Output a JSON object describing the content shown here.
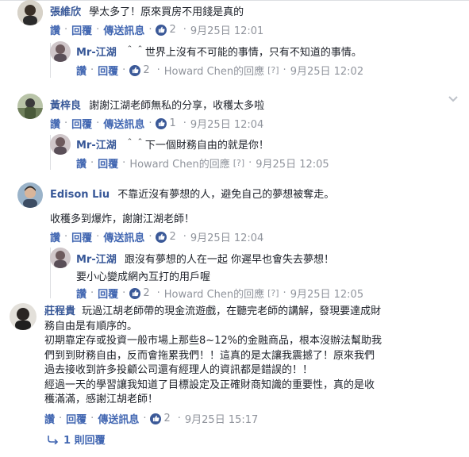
{
  "comments": [
    {
      "author": "張維欣",
      "text": "學太多了！原來買房不用錢是真的",
      "actions": {
        "like": "讚",
        "reply": "回覆",
        "message": "傳送訊息"
      },
      "reactions": "2",
      "time": "9月25日 12:01",
      "reply": {
        "author": "Mr-江湖",
        "text": "＾＾世界上沒有不可能的事情，只有不知道的事情。",
        "like": "讚",
        "reply": "回覆",
        "reactions": "2",
        "replied_to": "Howard Chen的回應",
        "help": "[?]",
        "time": "9月25日 12:02"
      }
    },
    {
      "author": "黃梓良",
      "text": "謝謝江湖老師無私的分享，收穫太多啦",
      "actions": {
        "like": "讚",
        "reply": "回覆",
        "message": "傳送訊息"
      },
      "reactions": "1",
      "time": "9月25日 12:04",
      "reply": {
        "author": "Mr-江湖",
        "text": "＾＾下一個財務自由的就是你！",
        "like": "讚",
        "reply": "回覆",
        "replied_to": "Howard Chen的回應",
        "help": "[?]",
        "time": "9月25日 12:05"
      }
    },
    {
      "author": "Edison Liu",
      "text": "不靠近沒有夢想的人，避免自己的夢想被奪走。",
      "text2": "收穫多到爆炸，謝謝江湖老師！",
      "actions": {
        "like": "讚",
        "reply": "回覆",
        "message": "傳送訊息"
      },
      "reactions": "2",
      "time": "9月25日 12:04",
      "reply": {
        "author": "Mr-江湖",
        "text": "跟沒有夢想的人在一起 你遲早也會失去夢想！",
        "text2": "要小心變成網內互打的用戶喔",
        "like": "讚",
        "reply": "回覆",
        "reactions": "2",
        "replied_to": "Howard Chen的回應",
        "help": "[?]",
        "time": "9月25日 12:05"
      }
    },
    {
      "author": "莊程貴",
      "lines": [
        "玩過江胡老師帶的現金流遊戲，在聽完老師的講解，發現要達成財",
        "務自由是有順序的。",
        "初期靠定存或投資一般市場上那些8~12%的金融商品，根本沒辦法幫助我",
        "們到到財務自由，反而會拖累我們！！這真的是太讓我震撼了！原來我們",
        "過去接收到許多投顧公司還有經理人的資訊都是錯誤的！！",
        "經過一天的學習讓我知道了目標設定及正確財商知識的重要性，真的是收",
        "穫滿滿，感謝江胡老師！"
      ],
      "actions": {
        "like": "讚",
        "reply": "回覆",
        "message": "傳送訊息"
      },
      "reactions": "2",
      "time": "9月25日 15:17",
      "more_replies": "1 則回覆"
    }
  ]
}
